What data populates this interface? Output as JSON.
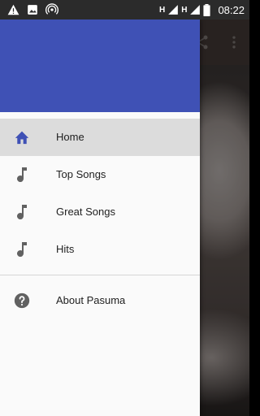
{
  "status_bar": {
    "network_1": "H",
    "network_2": "H",
    "time": "08:22"
  },
  "drawer": {
    "menu_items": [
      {
        "label": "Home",
        "icon": "home-icon",
        "active": true
      },
      {
        "label": "Top Songs",
        "icon": "music-note-icon",
        "active": false
      },
      {
        "label": "Great Songs",
        "icon": "music-note-icon",
        "active": false
      },
      {
        "label": "Hits",
        "icon": "music-note-icon",
        "active": false
      }
    ],
    "secondary_items": [
      {
        "label": "About Pasuma",
        "icon": "help-icon"
      }
    ]
  },
  "colors": {
    "header": "#3f51b5",
    "active_icon": "#3f51b5",
    "inactive_icon": "#616161"
  }
}
